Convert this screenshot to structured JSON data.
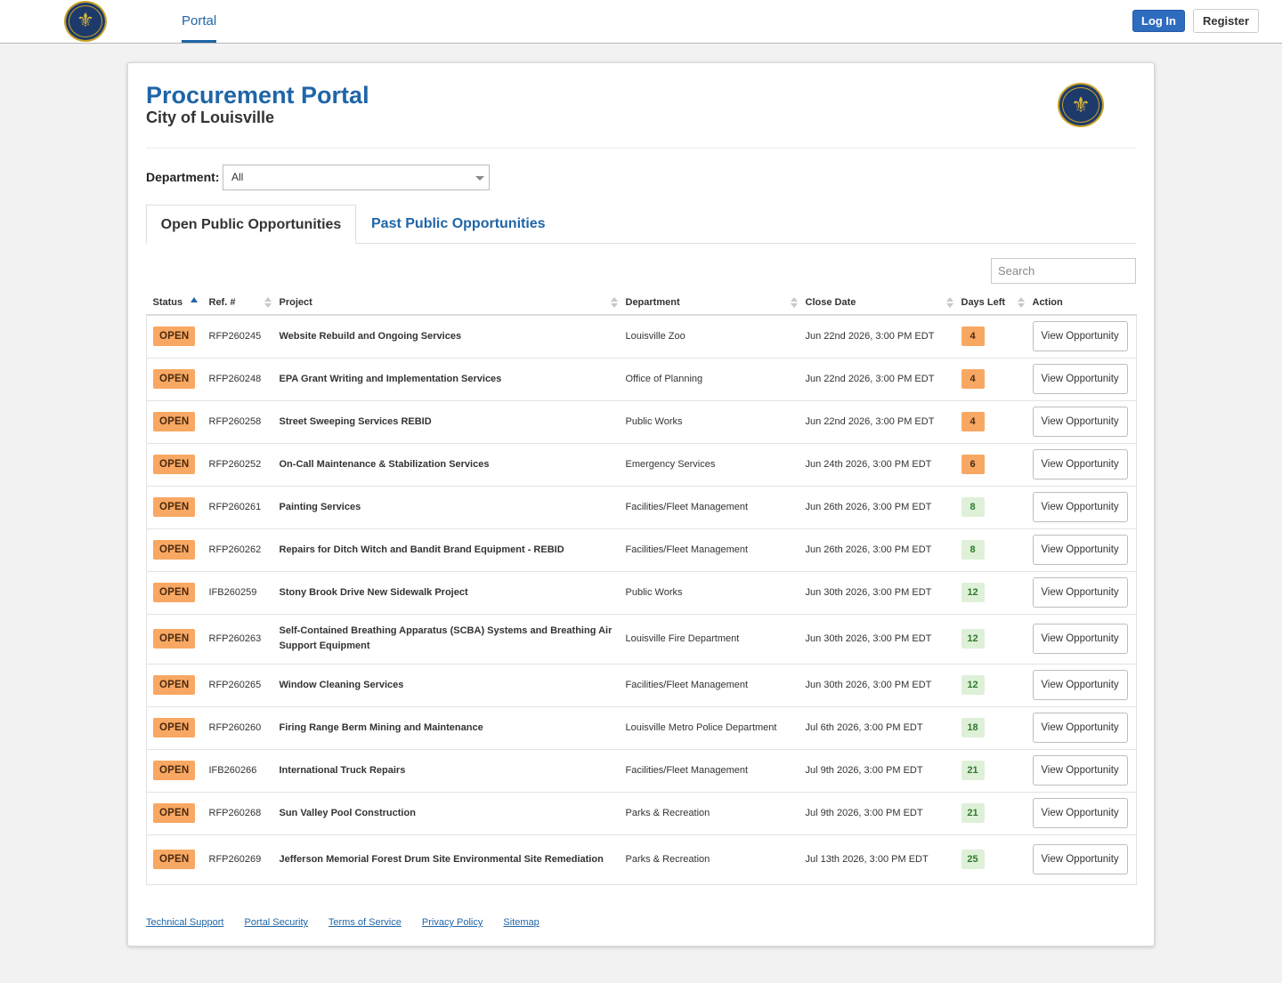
{
  "nav": {
    "portal_label": "Portal",
    "login_label": "Log In",
    "register_label": "Register",
    "logo_glyph": "⚜"
  },
  "header": {
    "title": "Procurement Portal",
    "subtitle": "City of Louisville",
    "logo_glyph": "⚜"
  },
  "filter": {
    "label": "Department:",
    "selected": "All"
  },
  "tabs": [
    {
      "label": "Open Public Opportunities",
      "active": true
    },
    {
      "label": "Past Public Opportunities",
      "active": false
    }
  ],
  "search": {
    "placeholder": "Search"
  },
  "table": {
    "headers": [
      "Status",
      "Ref. #",
      "Project",
      "Department",
      "Close Date",
      "Days Left",
      "Action"
    ],
    "rows": [
      {
        "status": "OPEN",
        "ref": "RFP260245",
        "project": "Website Rebuild and Ongoing Services",
        "department": "Louisville Zoo",
        "close": "Jun 22nd 2026, 3:00 PM EDT",
        "days": "4",
        "level": "warn",
        "action": "View Opportunity"
      },
      {
        "status": "OPEN",
        "ref": "RFP260248",
        "project": "EPA Grant Writing and Implementation Services",
        "department": "Office of Planning",
        "close": "Jun 22nd 2026, 3:00 PM EDT",
        "days": "4",
        "level": "warn",
        "action": "View Opportunity"
      },
      {
        "status": "OPEN",
        "ref": "RFP260258",
        "project": "Street Sweeping Services REBID",
        "department": "Public Works",
        "close": "Jun 22nd 2026, 3:00 PM EDT",
        "days": "4",
        "level": "warn",
        "action": "View Opportunity"
      },
      {
        "status": "OPEN",
        "ref": "RFP260252",
        "project": "On-Call Maintenance & Stabilization Services",
        "department": "Emergency Services",
        "close": "Jun 24th 2026, 3:00 PM EDT",
        "days": "6",
        "level": "warn",
        "action": "View Opportunity"
      },
      {
        "status": "OPEN",
        "ref": "RFP260261",
        "project": "Painting Services",
        "department": "Facilities/Fleet Management",
        "close": "Jun 26th 2026, 3:00 PM EDT",
        "days": "8",
        "level": "ok",
        "action": "View Opportunity"
      },
      {
        "status": "OPEN",
        "ref": "RFP260262",
        "project": "Repairs for Ditch Witch and Bandit Brand Equipment - REBID",
        "department": "Facilities/Fleet Management",
        "close": "Jun 26th 2026, 3:00 PM EDT",
        "days": "8",
        "level": "ok",
        "action": "View Opportunity"
      },
      {
        "status": "OPEN",
        "ref": "IFB260259",
        "project": "Stony Brook Drive New Sidewalk Project",
        "department": "Public Works",
        "close": "Jun 30th 2026, 3:00 PM EDT",
        "days": "12",
        "level": "ok",
        "action": "View Opportunity"
      },
      {
        "status": "OPEN",
        "ref": "RFP260263",
        "project": "Self-Contained Breathing Apparatus (SCBA) Systems and Breathing Air Support Equipment",
        "department": "Louisville Fire Department",
        "close": "Jun 30th 2026, 3:00 PM EDT",
        "days": "12",
        "level": "ok",
        "action": "View Opportunity",
        "tall": true
      },
      {
        "status": "OPEN",
        "ref": "RFP260265",
        "project": "Window Cleaning Services",
        "department": "Facilities/Fleet Management",
        "close": "Jun 30th 2026, 3:00 PM EDT",
        "days": "12",
        "level": "ok",
        "action": "View Opportunity"
      },
      {
        "status": "OPEN",
        "ref": "RFP260260",
        "project": "Firing Range Berm Mining and Maintenance",
        "department": "Louisville Metro Police Department",
        "close": "Jul 6th 2026, 3:00 PM EDT",
        "days": "18",
        "level": "ok",
        "action": "View Opportunity"
      },
      {
        "status": "OPEN",
        "ref": "IFB260266",
        "project": "International Truck Repairs",
        "department": "Facilities/Fleet Management",
        "close": "Jul 9th 2026, 3:00 PM EDT",
        "days": "21",
        "level": "ok",
        "action": "View Opportunity"
      },
      {
        "status": "OPEN",
        "ref": "RFP260268",
        "project": "Sun Valley Pool Construction",
        "department": "Parks & Recreation",
        "close": "Jul 9th 2026, 3:00 PM EDT",
        "days": "21",
        "level": "ok",
        "action": "View Opportunity"
      },
      {
        "status": "OPEN",
        "ref": "RFP260269",
        "project": "Jefferson Memorial Forest Drum Site Environmental Site Remediation",
        "department": "Parks & Recreation",
        "close": "Jul 13th 2026, 3:00 PM EDT",
        "days": "25",
        "level": "ok",
        "action": "View Opportunity",
        "tall": true
      }
    ]
  },
  "footer": {
    "links": [
      "Technical Support",
      "Portal Security",
      "Terms of Service",
      "Privacy Policy",
      "Sitemap"
    ]
  },
  "colors": {
    "brand_blue": "#1f65a8",
    "status_orange": "#f8a862",
    "ok_green_bg": "#dff0d8",
    "ok_green_text": "#2d7a2d"
  }
}
